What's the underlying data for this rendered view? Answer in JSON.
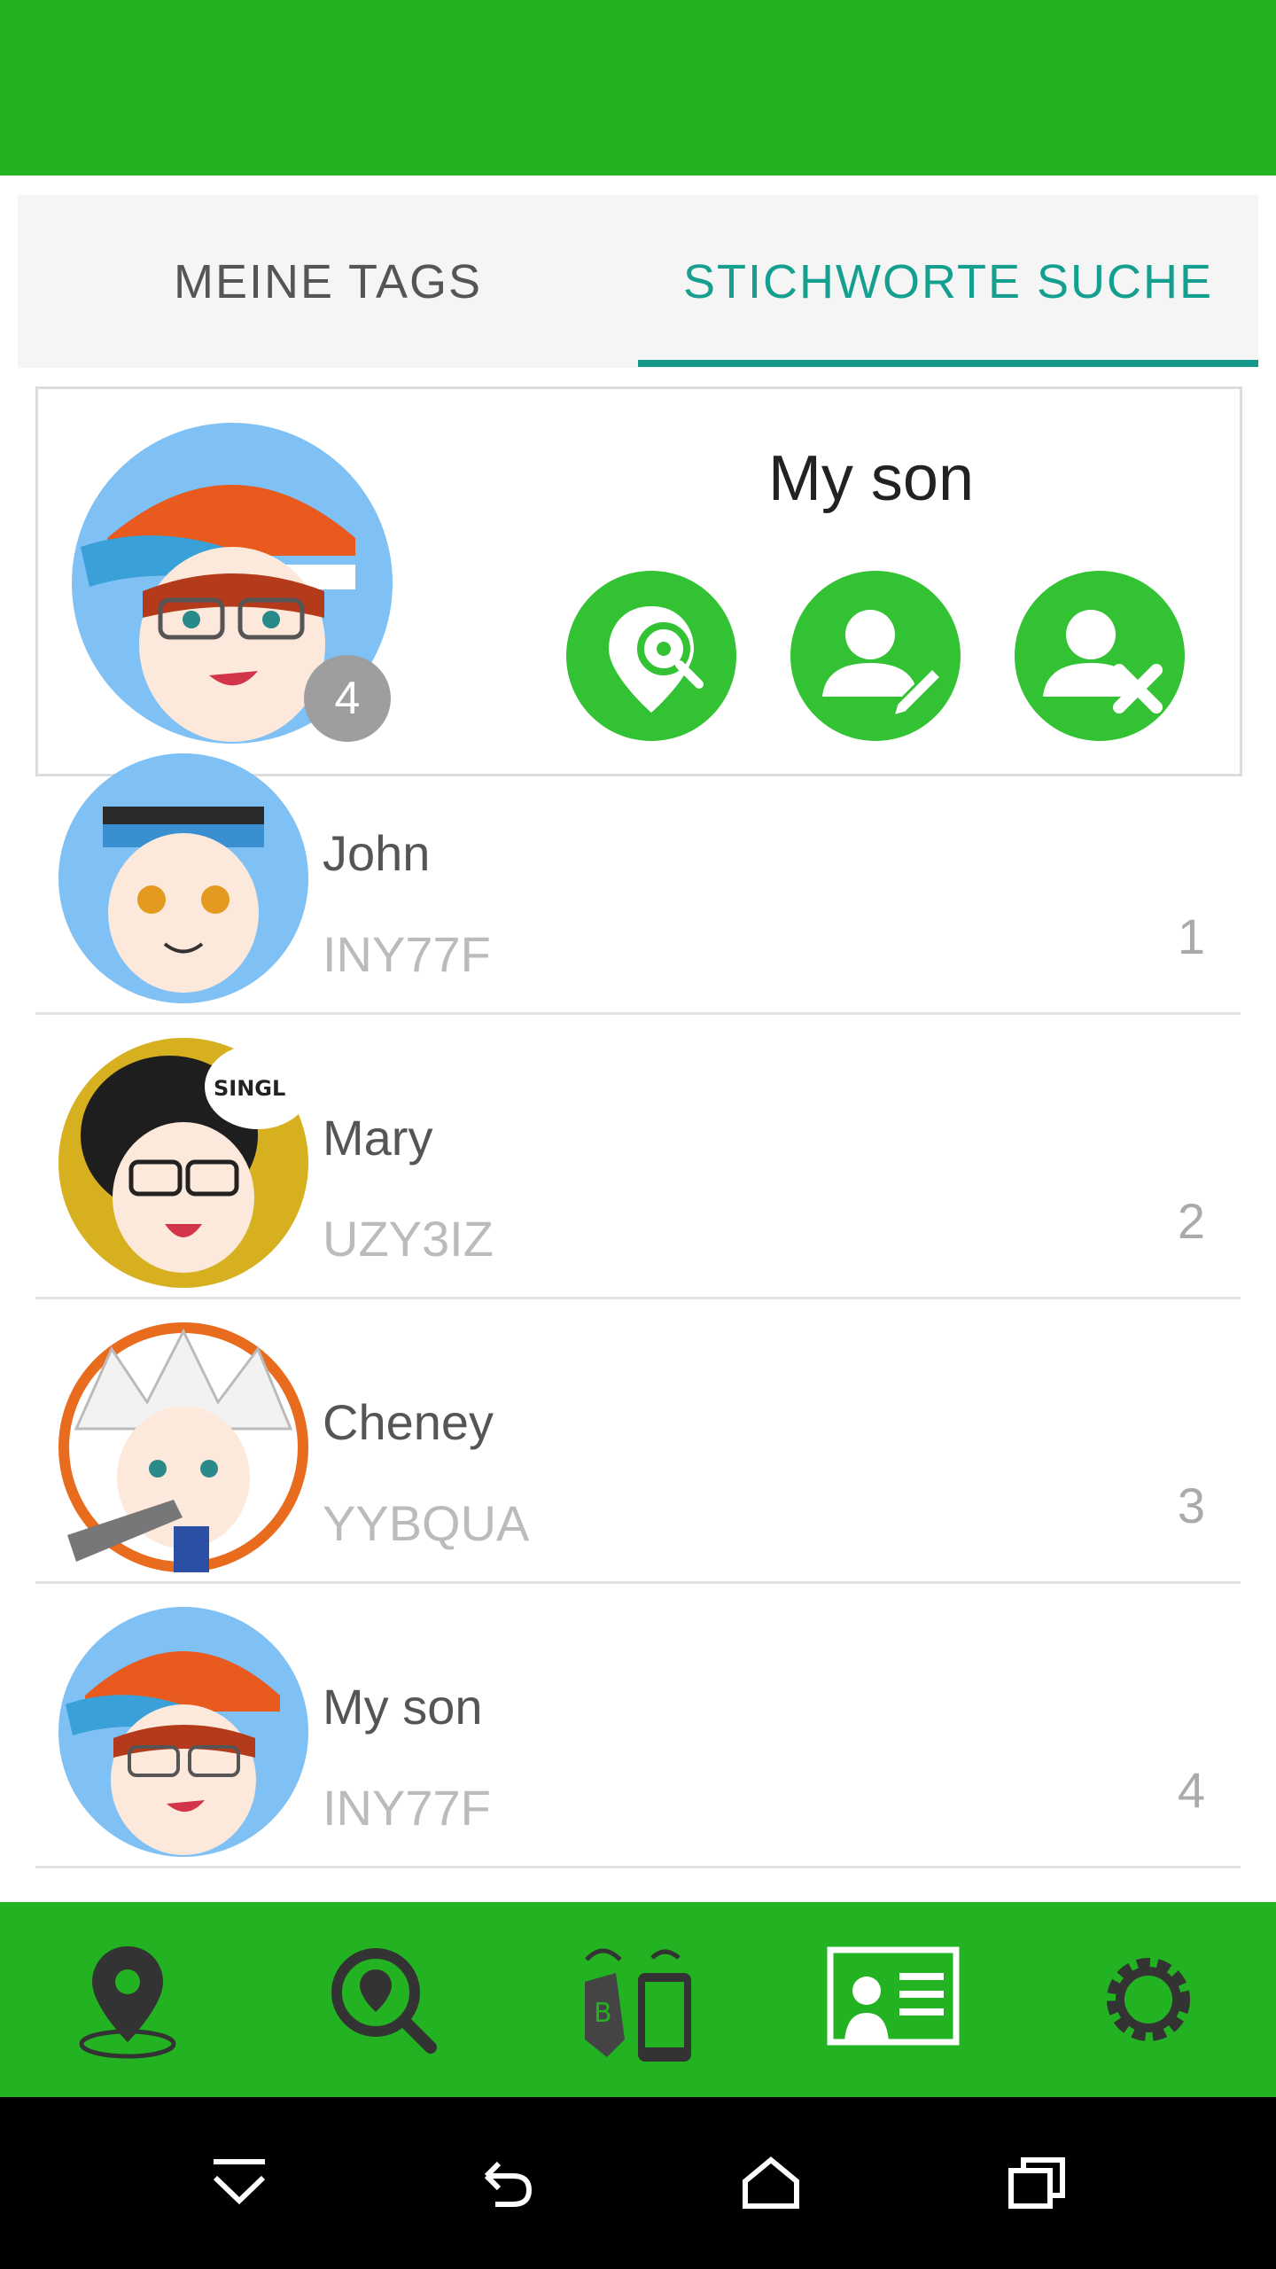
{
  "tabs": {
    "mine": "MEINE TAGS",
    "search": "STICHWORTE SUCHE"
  },
  "selected_tag": {
    "name": "My son",
    "badge_count": "4"
  },
  "actions": [
    "locate-search-icon",
    "edit-user-icon",
    "remove-user-icon"
  ],
  "list": [
    {
      "name": "John",
      "code": "INY77F",
      "number": "1"
    },
    {
      "name": "Mary",
      "code": "UZY3IZ",
      "number": "2"
    },
    {
      "name": "Cheney",
      "code": "YYBQUA",
      "number": "3"
    },
    {
      "name": "My son",
      "code": "INY77F",
      "number": "4"
    }
  ],
  "mary_bubble": "SINGL",
  "bottom_nav": [
    "map-pin-icon",
    "search-location-icon",
    "beacon-phone-icon",
    "id-card-icon",
    "settings-gear-icon"
  ],
  "system_nav": [
    "hide-keyboard-icon",
    "back-icon",
    "home-icon",
    "recents-icon"
  ],
  "colors": {
    "header_green": "#22b222",
    "action_green": "#33c233",
    "accent_teal": "#15998a",
    "nav_icon_dark": "#333333"
  }
}
